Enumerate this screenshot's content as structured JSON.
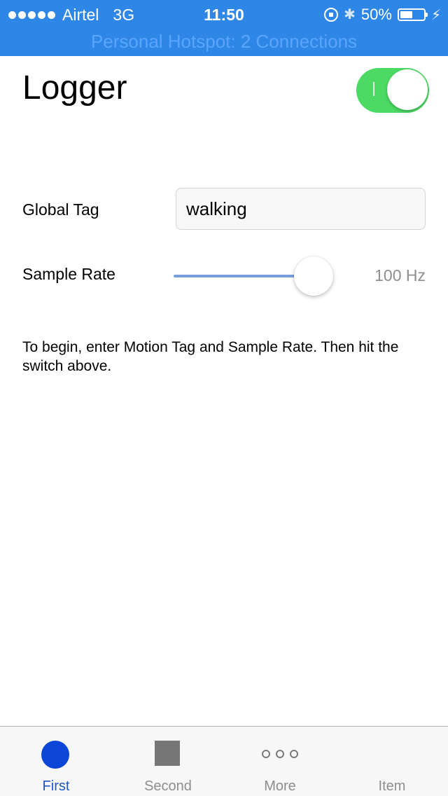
{
  "status_bar": {
    "carrier": "Airtel",
    "network": "3G",
    "time": "11:50",
    "battery_percent": "50%",
    "battery_level": 0.5,
    "hotspot_text": "Personal Hotspot: 2 Connections",
    "background_color": "#2e86e6",
    "icons": [
      "signal-dots-icon",
      "rotation-lock-icon",
      "bluetooth-icon",
      "battery-icon",
      "charging-bolt-icon"
    ]
  },
  "header": {
    "title": "Logger",
    "switch_on": true,
    "switch_on_color": "#4cd964"
  },
  "form": {
    "global_tag": {
      "label": "Global Tag",
      "value": "walking"
    },
    "sample_rate": {
      "label": "Sample Rate",
      "value_text": "100 Hz",
      "slider_fraction": 0.78
    }
  },
  "instructions": "To begin, enter Motion Tag and Sample Rate. Then hit the switch above.",
  "tab_bar": {
    "active_color": "#1e56c8",
    "tabs": [
      {
        "label": "First",
        "icon": "circle-icon",
        "active": true
      },
      {
        "label": "Second",
        "icon": "square-icon",
        "active": false
      },
      {
        "label": "More",
        "icon": "more-dots-icon",
        "active": false
      },
      {
        "label": "Item",
        "icon": "",
        "active": false
      }
    ]
  }
}
